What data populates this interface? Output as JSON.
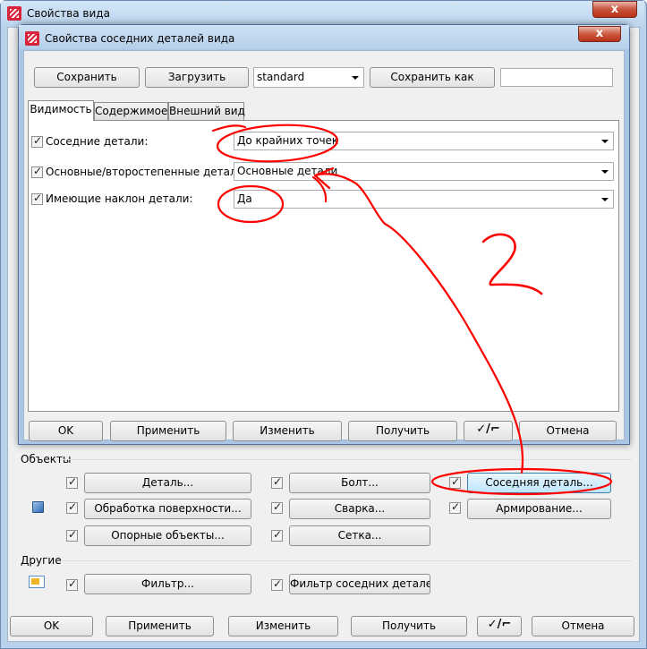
{
  "outer_window": {
    "title": "Свойства вида",
    "close_symbol": "x",
    "bottom_buttons": {
      "ok": "OK",
      "apply": "Применить",
      "modify": "Изменить",
      "get": "Получить",
      "toggle": "✓/⌐",
      "cancel": "Отмена"
    },
    "objects_group": {
      "title": "Объекты",
      "buttons": {
        "part": "Деталь...",
        "bolt": "Болт...",
        "neighbor_part": "Соседняя деталь...",
        "surface": "Обработка поверхности...",
        "weld": "Сварка...",
        "reinforcement": "Армирование...",
        "reference": "Опорные объекты...",
        "grid": "Сетка..."
      }
    },
    "others_group": {
      "title": "Другие",
      "buttons": {
        "filter": "Фильтр...",
        "neighbor_filter": "Фильтр соседних деталей..."
      }
    }
  },
  "inner_dialog": {
    "title": "Свойства соседних деталей вида",
    "close_symbol": "x",
    "toolbar": {
      "save": "Сохранить",
      "load": "Загрузить",
      "preset": "standard",
      "save_as": "Сохранить как",
      "save_as_value": ""
    },
    "tabs": [
      "Видимость",
      "Содержимое",
      "Внешний вид"
    ],
    "fields": [
      {
        "label": "Соседние детали:",
        "value": "До крайних точек",
        "checked": true
      },
      {
        "label": "Основные/второстепенные детали:",
        "value": "Основные детали",
        "checked": true
      },
      {
        "label": "Имеющие наклон детали:",
        "value": "Да",
        "checked": true
      }
    ],
    "bottom_buttons": {
      "ok": "OK",
      "apply": "Применить",
      "modify": "Изменить",
      "get": "Получить",
      "toggle": "✓/⌐",
      "cancel": "Отмена"
    }
  },
  "annotation": {
    "text": "2",
    "color": "#ff0000"
  }
}
